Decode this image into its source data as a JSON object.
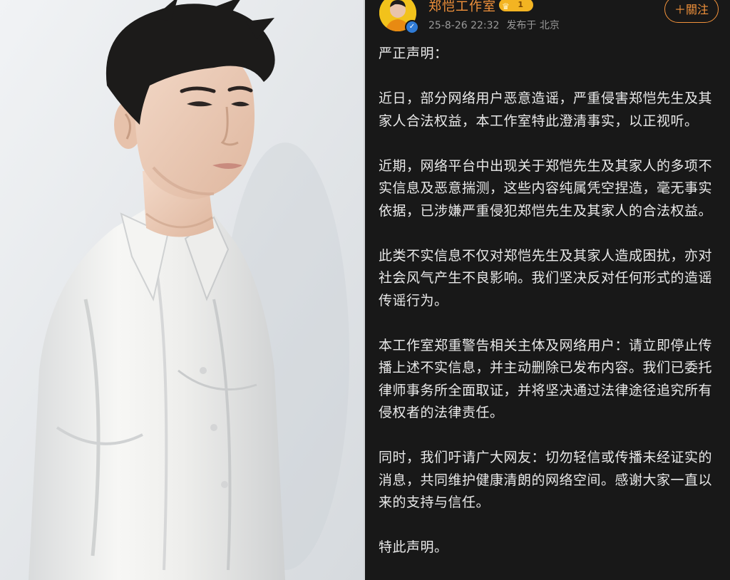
{
  "post": {
    "account_name": "郑恺工作室",
    "level": "1",
    "timestamp": "25-8-26 22:32",
    "location": "发布于 北京",
    "follow_label": "＋關注",
    "verified_mark": "✓",
    "paragraphs": [
      "严正声明：",
      "近日，部分网络用户恶意造谣，严重侵害郑恺先生及其家人合法权益，本工作室特此澄清事实，以正视听。",
      "近期，网络平台中出现关于郑恺先生及其家人的多项不实信息及恶意揣测，这些内容纯属凭空捏造，毫无事实依据，已涉嫌严重侵犯郑恺先生及其家人的合法权益。",
      "此类不实信息不仅对郑恺先生及其家人造成困扰，亦对社会风气产生不良影响。我们坚决反对任何形式的造谣传谣行为。",
      "本工作室郑重警告相关主体及网络用户：请立即停止传播上述不实信息，并主动删除已发布内容。我们已委托律师事务所全面取证，并将坚决通过法律途径追究所有侵权者的法律责任。",
      "同时，我们吁请广大网友：切勿轻信或传播未经证实的消息，共同维护健康清朗的网络空间。感谢大家一直以来的支持与信任。",
      "特此声明。"
    ]
  },
  "colors": {
    "post_background": "#181818",
    "accent_orange": "#f2923b",
    "meta_gray": "#9a9a9a",
    "text": "#e9e9e9",
    "avatar_yellow": "#f2c21b",
    "verified_blue": "#2f7bd6"
  },
  "icons": {
    "verified": "verified-icon",
    "crown": "crown-icon"
  }
}
